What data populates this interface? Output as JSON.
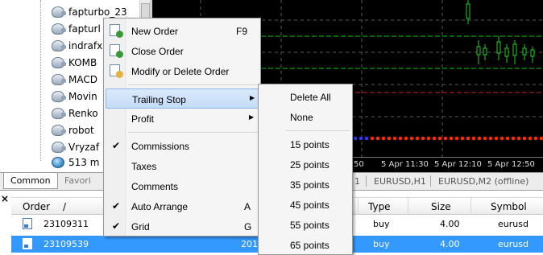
{
  "navigator": {
    "items": [
      {
        "label": "fapturbo_23",
        "icon": "expert-advisor-icon"
      },
      {
        "label": "fapturl",
        "icon": "expert-advisor-icon"
      },
      {
        "label": "indrafx",
        "icon": "expert-advisor-icon"
      },
      {
        "label": "KOMB",
        "icon": "expert-advisor-icon"
      },
      {
        "label": "MACD",
        "icon": "expert-advisor-icon"
      },
      {
        "label": "Movin",
        "icon": "expert-advisor-icon"
      },
      {
        "label": "Renko",
        "icon": "expert-advisor-icon"
      },
      {
        "label": "robot",
        "icon": "expert-advisor-icon"
      },
      {
        "label": "Vryzaf",
        "icon": "expert-advisor-icon"
      },
      {
        "label": "513 m",
        "icon": "globe-icon"
      }
    ],
    "tabs": {
      "common": "Common",
      "favorites": "Favori"
    }
  },
  "chart": {
    "time_labels": [
      "50",
      "5 Apr 11:30",
      "5 Apr 12:10",
      "5 Apr 12:50"
    ],
    "tabs": [
      "1",
      "EURUSD,H1",
      "EURUSD,M2 (offline)"
    ],
    "colors": {
      "background": "#000000",
      "up": "#22cc22",
      "dots_red": "#ff2a00",
      "dots_blue": "#3333ff"
    }
  },
  "terminal": {
    "close_glyph": "×",
    "headers": {
      "order": "Order",
      "sort": "/",
      "type": "Type",
      "size": "Size",
      "symbol": "Symbol"
    },
    "rows": [
      {
        "order": "23109311",
        "mid": "",
        "type": "buy",
        "size": "4.00",
        "symbol": "eurusd",
        "selected": false
      },
      {
        "order": "23109539",
        "mid": "201",
        "type": "buy",
        "size": "4.00",
        "symbol": "eurusd",
        "selected": true
      }
    ]
  },
  "context_menu": {
    "items": [
      {
        "label": "New Order",
        "shortcut": "F9",
        "icon": "new-order-icon"
      },
      {
        "label": "Close Order",
        "shortcut": "",
        "icon": "close-order-icon"
      },
      {
        "label": "Modify or Delete Order",
        "shortcut": "",
        "icon": "modify-order-icon"
      },
      {
        "label": "Trailing Stop",
        "submenu": true
      },
      {
        "label": "Profit",
        "submenu": true
      },
      {
        "label": "Commissions",
        "checked": true
      },
      {
        "label": "Taxes"
      },
      {
        "label": "Comments"
      },
      {
        "label": "Auto Arrange",
        "shortcut": "A",
        "checked": true
      },
      {
        "label": "Grid",
        "shortcut": "G",
        "checked": true
      }
    ],
    "check_glyph": "✔",
    "arrow_glyph": "▶"
  },
  "trailing_submenu": {
    "items": [
      "Delete All",
      "None",
      "15 points",
      "25 points",
      "35 points",
      "45 points",
      "55 points",
      "65 points"
    ]
  }
}
